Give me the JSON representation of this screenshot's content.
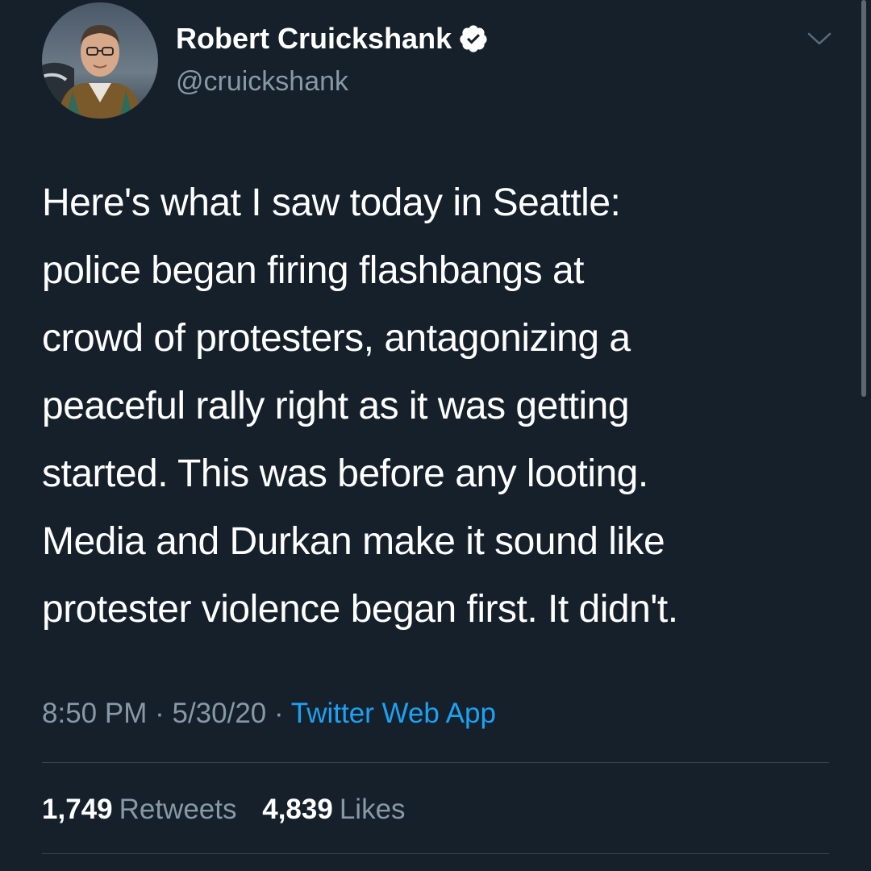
{
  "tweet": {
    "author": {
      "display_name": "Robert Cruickshank",
      "handle": "@cruickshank",
      "verified": true,
      "verified_icon": "verified-badge-icon",
      "avatar_icon": "profile-photo"
    },
    "menu_icon": "chevron-down-icon",
    "text_lines": [
      "Here's what I saw today in Seattle:",
      "police began firing flashbangs at",
      "crowd of protesters, antagonizing a",
      "peaceful rally right as it was getting",
      "started. This was before any looting.",
      "Media and Durkan make it sound like",
      "protester violence began first. It didn't."
    ],
    "time": "8:50 PM",
    "date": "5/30/20",
    "separator": "·",
    "source": "Twitter Web App",
    "retweets": {
      "count": "1,749",
      "label": "Retweets"
    },
    "likes": {
      "count": "4,839",
      "label": "Likes"
    }
  },
  "colors": {
    "background": "#15202b",
    "text_primary": "#ffffff",
    "text_secondary": "#8899a6",
    "accent": "#1da1f2",
    "divider": "#38444d"
  }
}
